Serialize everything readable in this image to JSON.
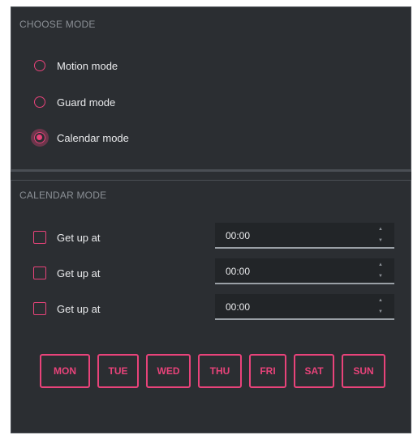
{
  "choose_mode": {
    "title": "CHOOSE MODE",
    "options": [
      {
        "label": "Motion mode",
        "checked": false
      },
      {
        "label": "Guard mode",
        "checked": false
      },
      {
        "label": "Calendar mode",
        "checked": true
      }
    ]
  },
  "calendar_mode": {
    "title": "CALENDAR MODE",
    "rows": [
      {
        "label": "Get up at",
        "time": "00:00",
        "checked": false
      },
      {
        "label": "Get up at",
        "time": "00:00",
        "checked": false
      },
      {
        "label": "Get up at",
        "time": "00:00",
        "checked": false
      }
    ],
    "days": [
      "MON",
      "TUE",
      "WED",
      "THU",
      "FRI",
      "SAT",
      "SUN"
    ]
  },
  "spinner": {
    "up_icon": "triangle-up-icon",
    "down_icon": "triangle-down-icon"
  },
  "colors": {
    "accent": "#e8437a",
    "panel_bg": "#2b2e32",
    "field_bg": "#222528",
    "text": "#e9eaec",
    "muted": "#8b9096"
  }
}
